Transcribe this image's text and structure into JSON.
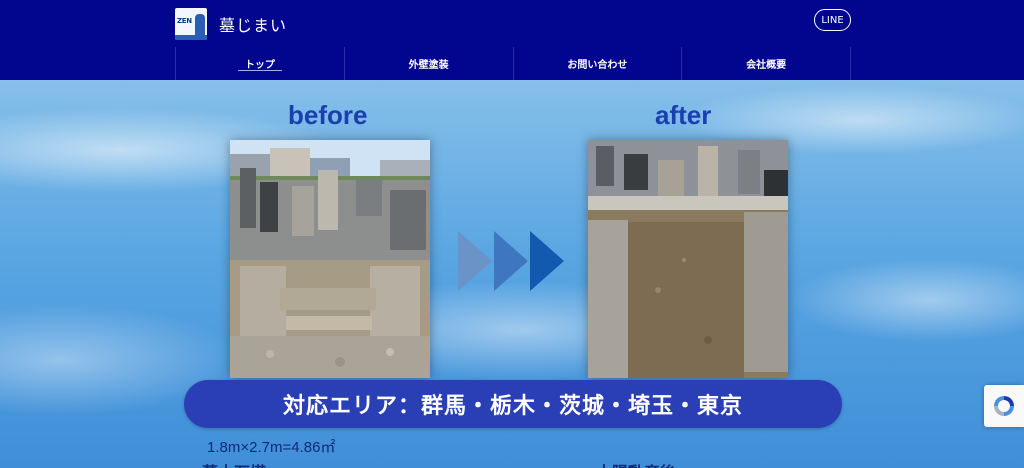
{
  "header": {
    "logo_text": "ZEN",
    "site_name": "墓じまい",
    "line_button": "LINE"
  },
  "nav": {
    "items": [
      {
        "label": "トップ",
        "active": true
      },
      {
        "label": "外壁塗装",
        "active": false
      },
      {
        "label": "お問い合わせ",
        "active": false
      },
      {
        "label": "会社概要",
        "active": false
      }
    ]
  },
  "hero": {
    "before_label": "before",
    "after_label": "after",
    "banner": "対応エリア：群馬・栃木・茨城・埼玉・東京",
    "spec": "1.8m×2.7m=4.86㎡",
    "cut_left": "墓大石塔",
    "cut_right": "太陽動産後"
  },
  "colors": {
    "header_bg": "#02058e",
    "accent": "#1a3fae",
    "banner_bg": "#2a3fb6",
    "arrow_light": "#5f8fcf",
    "arrow_dark": "#1d5fb8"
  },
  "icons": {
    "arrows": "triple-chevron-right-icon",
    "recaptcha": "recaptcha-icon"
  }
}
